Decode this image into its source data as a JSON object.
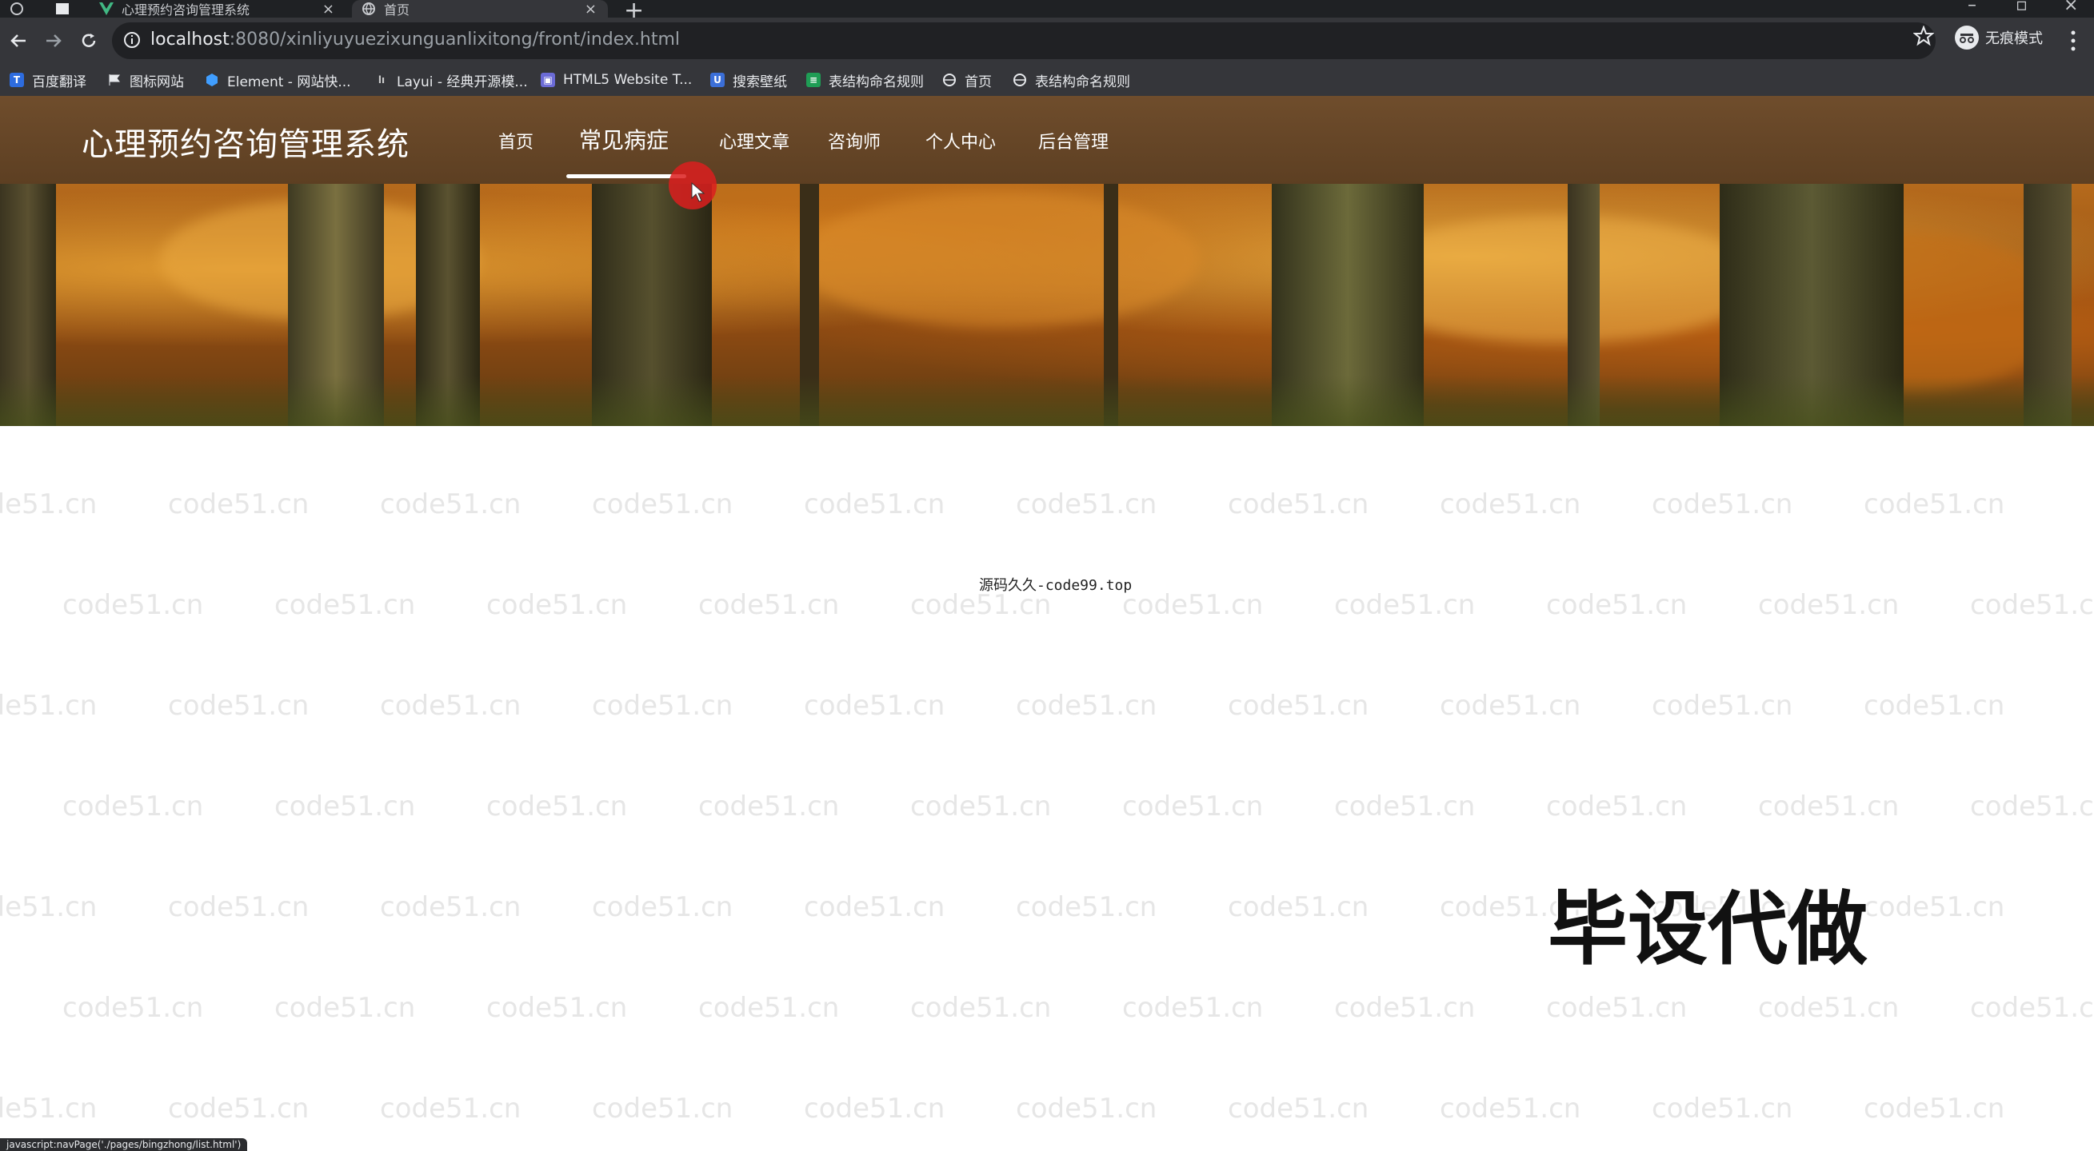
{
  "browser": {
    "tabs": [
      {
        "label": "心理预约咨询管理系统",
        "active": false
      },
      {
        "label": "首页",
        "active": true
      }
    ],
    "new_tab": "+",
    "url": {
      "host": "localhost",
      "rest": ":8080/xinliyuyuezixunguanlixitong/front/index.html"
    },
    "incognito_label": "无痕模式",
    "bookmarks": [
      {
        "label": "百度翻译",
        "icon": "baidu-fanyi-icon",
        "color": "#2d6cdf"
      },
      {
        "label": "图标网站",
        "icon": "flag-icon",
        "color": "#ffffff"
      },
      {
        "label": "Element - 网站快...",
        "icon": "element-icon",
        "color": "#409eff"
      },
      {
        "label": "Layui - 经典开源模...",
        "icon": "layui-icon",
        "color": "#cccccc"
      },
      {
        "label": "HTML5 Website T...",
        "icon": "html5-icon",
        "color": "#6b6bd6"
      },
      {
        "label": "搜索壁纸",
        "icon": "wallpaper-icon",
        "color": "#3b6fd8"
      },
      {
        "label": "表结构命名规则",
        "icon": "sheet-icon",
        "color": "#1f9d55"
      },
      {
        "label": "首页",
        "icon": "globe-icon",
        "color": "#e8eaed"
      },
      {
        "label": "表结构命名规则",
        "icon": "globe-icon",
        "color": "#e8eaed"
      }
    ],
    "status_tip": "javascript:navPage('./pages/bingzhong/list.html')"
  },
  "site": {
    "title": "心理预约咨询管理系统",
    "menu": [
      {
        "label": "首页",
        "active": false
      },
      {
        "label": "常见病症",
        "active": true
      },
      {
        "label": "心理文章",
        "active": false
      },
      {
        "label": "咨询师",
        "active": false
      },
      {
        "label": "个人中心",
        "active": false
      },
      {
        "label": "后台管理",
        "active": false
      }
    ],
    "header_color": "#6f4d2c"
  },
  "content": {
    "watermark": "code51.cn",
    "source_note": "源码久久-code99.top",
    "overlay_text": "毕设代做"
  }
}
